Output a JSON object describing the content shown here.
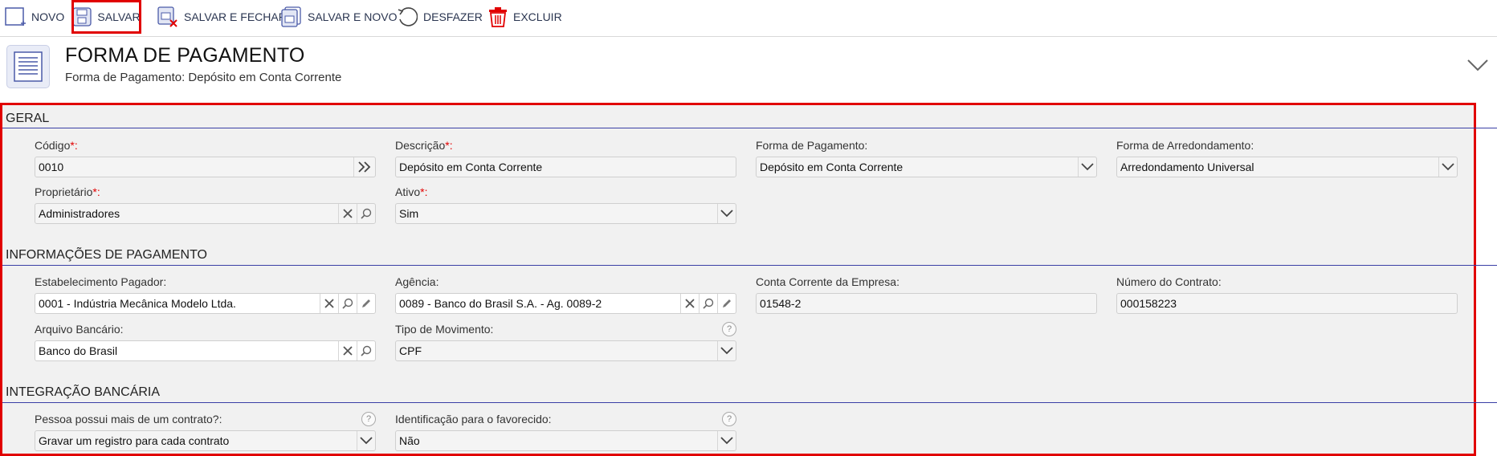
{
  "toolbar": {
    "novo": "NOVO",
    "salvar": "SALVAR",
    "salvar_fechar": "SALVAR E FECHAR",
    "salvar_novo": "SALVAR E NOVO",
    "desfazer": "DESFAZER",
    "excluir": "EXCLUIR"
  },
  "header": {
    "title": "FORMA DE PAGAMENTO",
    "subtitle": "Forma de Pagamento: Depósito em Conta Corrente"
  },
  "sections": {
    "geral": "GERAL",
    "informacoes": "INFORMAÇÕES DE PAGAMENTO",
    "integracao": "INTEGRAÇÃO BANCÁRIA"
  },
  "fields": {
    "codigo": {
      "label": "Código",
      "required": "*:",
      "value": "0010"
    },
    "descricao": {
      "label": "Descrição",
      "required": "*:",
      "value": "Depósito em Conta Corrente"
    },
    "forma_pagamento": {
      "label": "Forma de Pagamento:",
      "value": "Depósito em Conta Corrente"
    },
    "forma_arredondamento": {
      "label": "Forma de Arredondamento:",
      "value": "Arredondamento Universal"
    },
    "proprietario": {
      "label": "Proprietário",
      "required": "*:",
      "value": "Administradores"
    },
    "ativo": {
      "label": "Ativo",
      "required": "*:",
      "value": "Sim"
    },
    "estabelecimento": {
      "label": "Estabelecimento Pagador:",
      "value": "0001 - Indústria Mecânica Modelo Ltda."
    },
    "agencia": {
      "label": "Agência:",
      "value": "0089 - Banco do Brasil S.A. - Ag. 0089-2"
    },
    "conta_corrente": {
      "label": "Conta Corrente da Empresa:",
      "value": "01548-2"
    },
    "numero_contrato": {
      "label": "Número do Contrato:",
      "value": "000158223"
    },
    "arquivo_bancario": {
      "label": "Arquivo Bancário:",
      "value": "Banco do Brasil"
    },
    "tipo_movimento": {
      "label": "Tipo de Movimento:",
      "value": "CPF",
      "help": "?"
    },
    "pessoa_contrato": {
      "label": "Pessoa possui mais de um contrato?:",
      "value": "Gravar um registro para cada contrato",
      "help": "?"
    },
    "identificacao_favorecido": {
      "label": "Identificação para o favorecido:",
      "value": "Não",
      "help": "?"
    }
  },
  "icons": {
    "new": "new-document-icon",
    "save": "floppy-icon",
    "save_close": "save-close-icon",
    "save_new": "save-new-icon",
    "undo": "undo-icon",
    "delete": "trash-icon",
    "header": "list-document-icon",
    "collapse": "chevron-down-icon"
  },
  "colors": {
    "accent_red": "#e10000",
    "section_line": "#3a3fa6",
    "form_bg": "#f1f1f1"
  }
}
